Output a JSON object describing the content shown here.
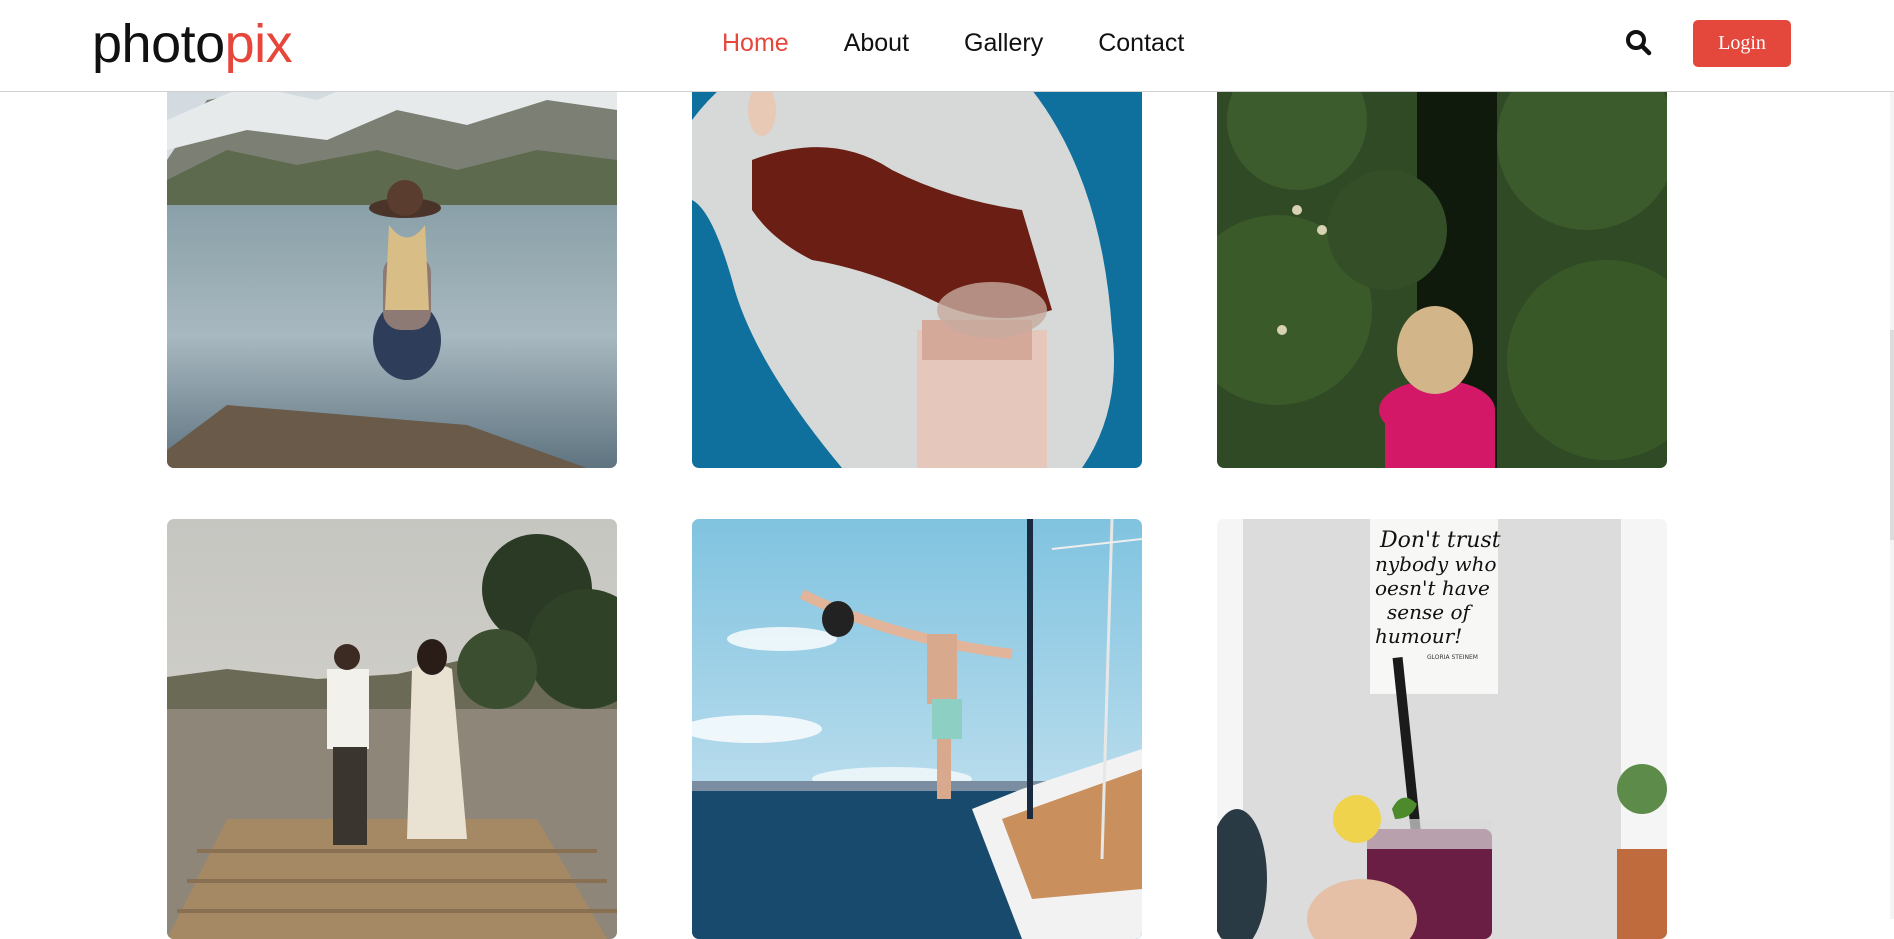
{
  "brand": {
    "logo_main": "photo",
    "logo_accent": "pix"
  },
  "nav": {
    "items": [
      {
        "label": "Home",
        "active": true
      },
      {
        "label": "About",
        "active": false
      },
      {
        "label": "Gallery",
        "active": false
      },
      {
        "label": "Contact",
        "active": false
      }
    ]
  },
  "header": {
    "search_icon": "search-icon",
    "login_label": "Login"
  },
  "colors": {
    "accent": "#e7463b",
    "button": "#e4483d"
  },
  "gallery": {
    "images": [
      {
        "subject": "woman in hat sitting on dock by mountain lake"
      },
      {
        "subject": "person holding white lace veil against blue sky"
      },
      {
        "subject": "child looking into green hedge"
      },
      {
        "subject": "couple walking on wooden pier by the sea"
      },
      {
        "subject": "man leaning off sailboat over the sea"
      },
      {
        "subject": "hand holding purple drink in front of poster"
      }
    ],
    "poster_text": [
      "Don't trust",
      "nybody who",
      "oesn't have",
      "sense of",
      "humour!"
    ],
    "poster_credit": "GLORIA STEINEM"
  }
}
